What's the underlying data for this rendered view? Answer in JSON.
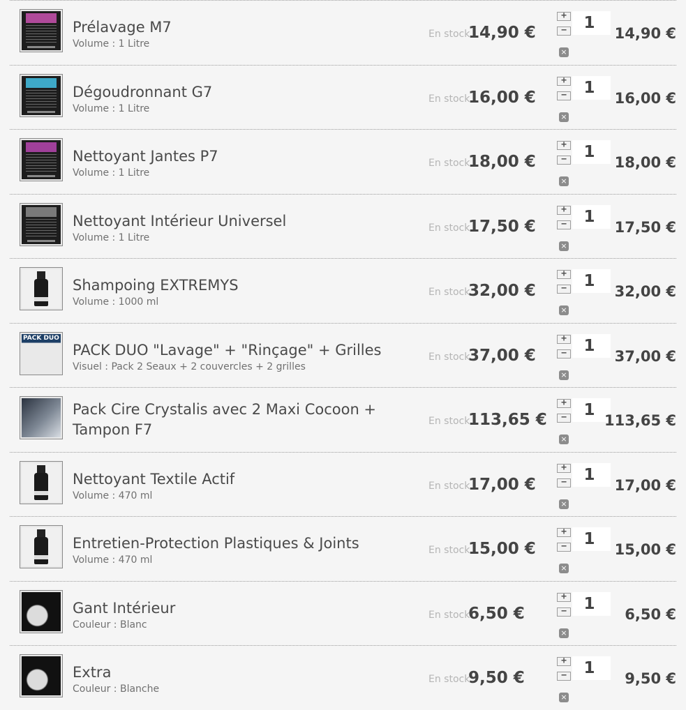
{
  "stock_label": "En stock",
  "buttons": {
    "plus": "+",
    "minus": "−",
    "remove": "×"
  },
  "items": [
    {
      "name": "Prélavage M7",
      "variant": "Volume : 1 Litre",
      "unit_price": "14,90 €",
      "qty": "1",
      "total": "14,90 €",
      "thumb": "label",
      "thumb_color": "#b04a9a"
    },
    {
      "name": "Dégoudronnant G7",
      "variant": "Volume : 1 Litre",
      "unit_price": "16,00 €",
      "qty": "1",
      "total": "16,00 €",
      "thumb": "label",
      "thumb_color": "#3ea9c8"
    },
    {
      "name": "Nettoyant Jantes P7",
      "variant": "Volume : 1 Litre",
      "unit_price": "18,00 €",
      "qty": "1",
      "total": "18,00 €",
      "thumb": "label",
      "thumb_color": "#a0409a"
    },
    {
      "name": "Nettoyant Intérieur Universel",
      "variant": "Volume : 1 Litre",
      "unit_price": "17,50 €",
      "qty": "1",
      "total": "17,50 €",
      "thumb": "label",
      "thumb_color": "#7a7a7a"
    },
    {
      "name": "Shampoing EXTREMYS",
      "variant": "Volume : 1000 ml",
      "unit_price": "32,00 €",
      "qty": "1",
      "total": "32,00 €",
      "thumb": "bottle"
    },
    {
      "name": "PACK DUO \"Lavage\" + \"Rinçage\" + Grilles",
      "variant": "Visuel : Pack 2 Seaux + 2 couvercles + 2 grilles",
      "unit_price": "37,00 €",
      "qty": "1",
      "total": "37,00 €",
      "thumb": "duo",
      "thumb_text": "PACK DUO"
    },
    {
      "name": "Pack Cire Crystalis avec 2 Maxi Cocoon + Tampon F7",
      "variant": "",
      "unit_price": "113,65 €",
      "qty": "1",
      "total": "113,65 €",
      "thumb": "photo"
    },
    {
      "name": "Nettoyant Textile Actif",
      "variant": "Volume : 470 ml",
      "unit_price": "17,00 €",
      "qty": "1",
      "total": "17,00 €",
      "thumb": "bottle"
    },
    {
      "name": "Entretien-Protection Plastiques & Joints",
      "variant": "Volume : 470 ml",
      "unit_price": "15,00 €",
      "qty": "1",
      "total": "15,00 €",
      "thumb": "bottle"
    },
    {
      "name": "Gant Intérieur",
      "variant": "Couleur : Blanc",
      "unit_price": "6,50 €",
      "qty": "1",
      "total": "6,50 €",
      "thumb": "dark"
    },
    {
      "name": "Extra",
      "variant": "Couleur : Blanche",
      "unit_price": "9,50 €",
      "qty": "1",
      "total": "9,50 €",
      "thumb": "dark"
    }
  ]
}
